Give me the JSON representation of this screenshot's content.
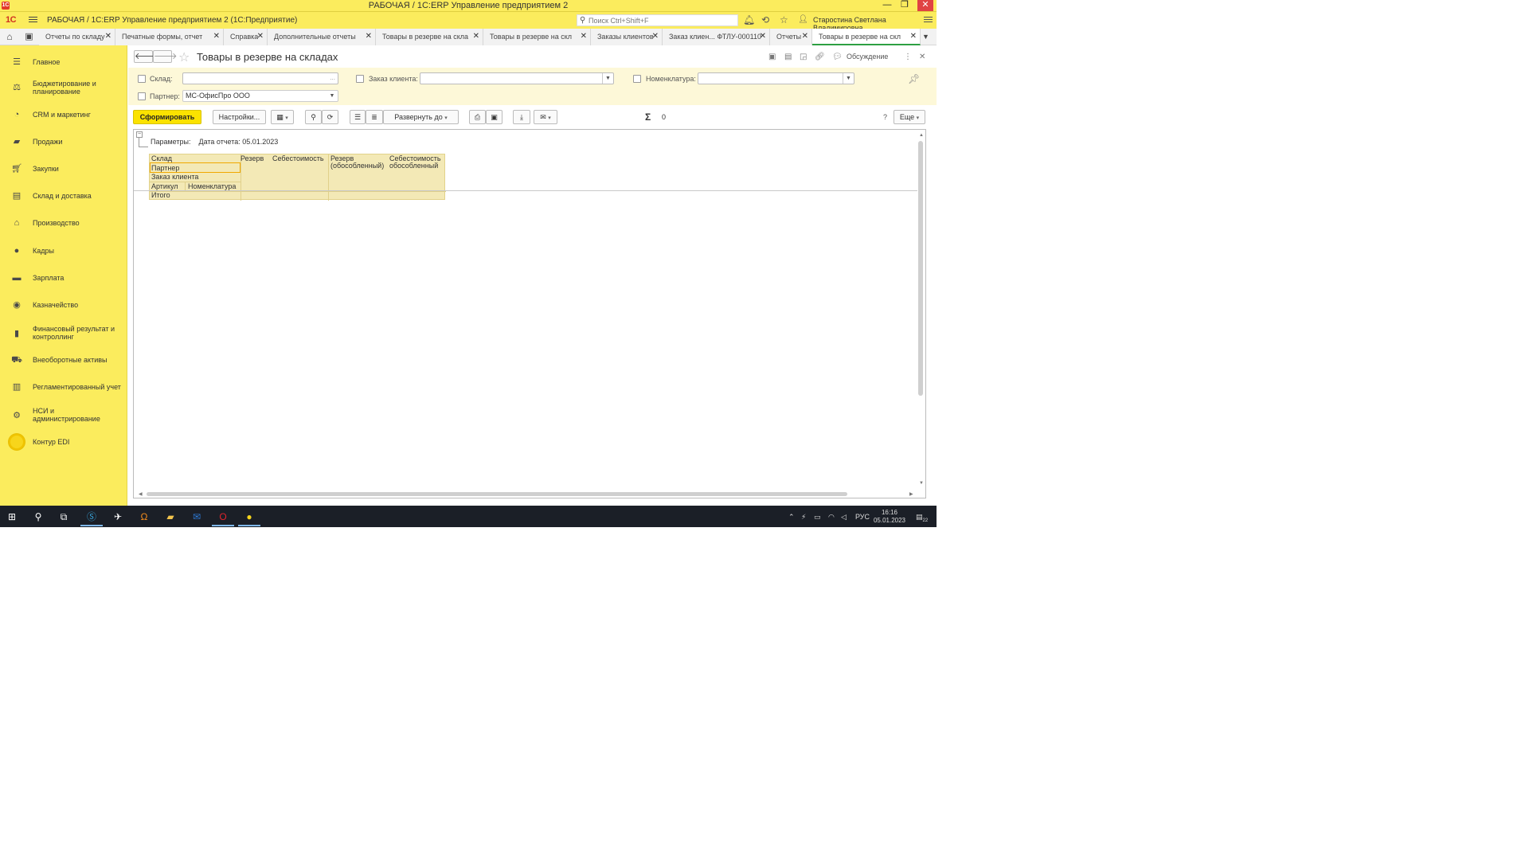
{
  "os_titlebar": {
    "title": "РАБОЧАЯ / 1С:ERP Управление предприятием 2",
    "minimize": "—",
    "maximize": "❐",
    "close": "✕"
  },
  "header": {
    "logo": "1С",
    "app_title": "РАБОЧАЯ / 1С:ERP Управление предприятием 2  (1С:Предприятие)",
    "search_placeholder": "Поиск Ctrl+Shift+F",
    "user": "Старостина Светлана Владимировна"
  },
  "tabs": [
    {
      "label": "Отчеты по складу",
      "active": false
    },
    {
      "label": "Печатные формы, отчет",
      "active": false
    },
    {
      "label": "Справка",
      "active": false
    },
    {
      "label": "Дополнительные отчеты",
      "active": false
    },
    {
      "label": "Товары в резерве на скла",
      "active": false
    },
    {
      "label": "Товары в резерве на скл",
      "active": false
    },
    {
      "label": "Заказы клиентов",
      "active": false
    },
    {
      "label": "Заказ клиен... ФТЛУ-000110",
      "active": false
    },
    {
      "label": "Отчеты",
      "active": false
    },
    {
      "label": "Товары в резерве на скл",
      "active": true
    }
  ],
  "sidebar": {
    "items": [
      {
        "label": "Главное",
        "icon": "menu-icon"
      },
      {
        "label": "Бюджетирование и планирование",
        "icon": "budget-icon"
      },
      {
        "label": "CRM и маркетинг",
        "icon": "crm-icon"
      },
      {
        "label": "Продажи",
        "icon": "sales-icon"
      },
      {
        "label": "Закупки",
        "icon": "cart-icon"
      },
      {
        "label": "Склад и доставка",
        "icon": "warehouse-icon"
      },
      {
        "label": "Производство",
        "icon": "factory-icon"
      },
      {
        "label": "Кадры",
        "icon": "person-icon"
      },
      {
        "label": "Зарплата",
        "icon": "salary-icon"
      },
      {
        "label": "Казначейство",
        "icon": "treasury-icon"
      },
      {
        "label": "Финансовый результат и контроллинг",
        "icon": "chart-icon"
      },
      {
        "label": "Внеоборотные активы",
        "icon": "truck-icon"
      },
      {
        "label": "Регламентированный учет",
        "icon": "book-icon"
      },
      {
        "label": "НСИ и администрирование",
        "icon": "gear-icon"
      },
      {
        "label": "Контур EDI",
        "icon": "kontur-icon"
      }
    ]
  },
  "form": {
    "title": "Товары в резерве на складах",
    "discuss_label": "Обсуждение"
  },
  "filters": {
    "sklad_label": "Склад:",
    "sklad_value": "",
    "zakaz_label": "Заказ клиента:",
    "zakaz_value": "",
    "nomen_label": "Номенклатура:",
    "nomen_value": "",
    "partner_label": "Партнер:",
    "partner_value": "МС-ОфисПро ООО"
  },
  "toolbar": {
    "generate": "Сформировать",
    "settings": "Настройки...",
    "expand_to": "Развернуть до",
    "sum_value": "0",
    "help": "?",
    "more": "Еще"
  },
  "report": {
    "params_label": "Параметры:",
    "params_value": "Дата отчета: 05.01.2023",
    "col_sklad": "Склад",
    "col_rezerv": "Резерв",
    "col_sebest": "Себестоимость",
    "col_rezerv_obosob": "Резерв (обособленный)",
    "col_sebest_obosob": "Себестоимость обособленный",
    "row_partner": "Партнер",
    "row_zakaz": "Заказ клиента",
    "row_artikul": "Артикул",
    "row_nomen": "Номенклатура",
    "row_itogo": "Итого"
  },
  "taskbar": {
    "lang": "РУС",
    "time": "16:16",
    "date": "05.01.2023",
    "notif": "22"
  },
  "colors": {
    "accent_yellow": "#fbec5d",
    "primary_button": "#fbe200",
    "active_tab": "#2ea043",
    "taskbar": "#1b1f27"
  }
}
